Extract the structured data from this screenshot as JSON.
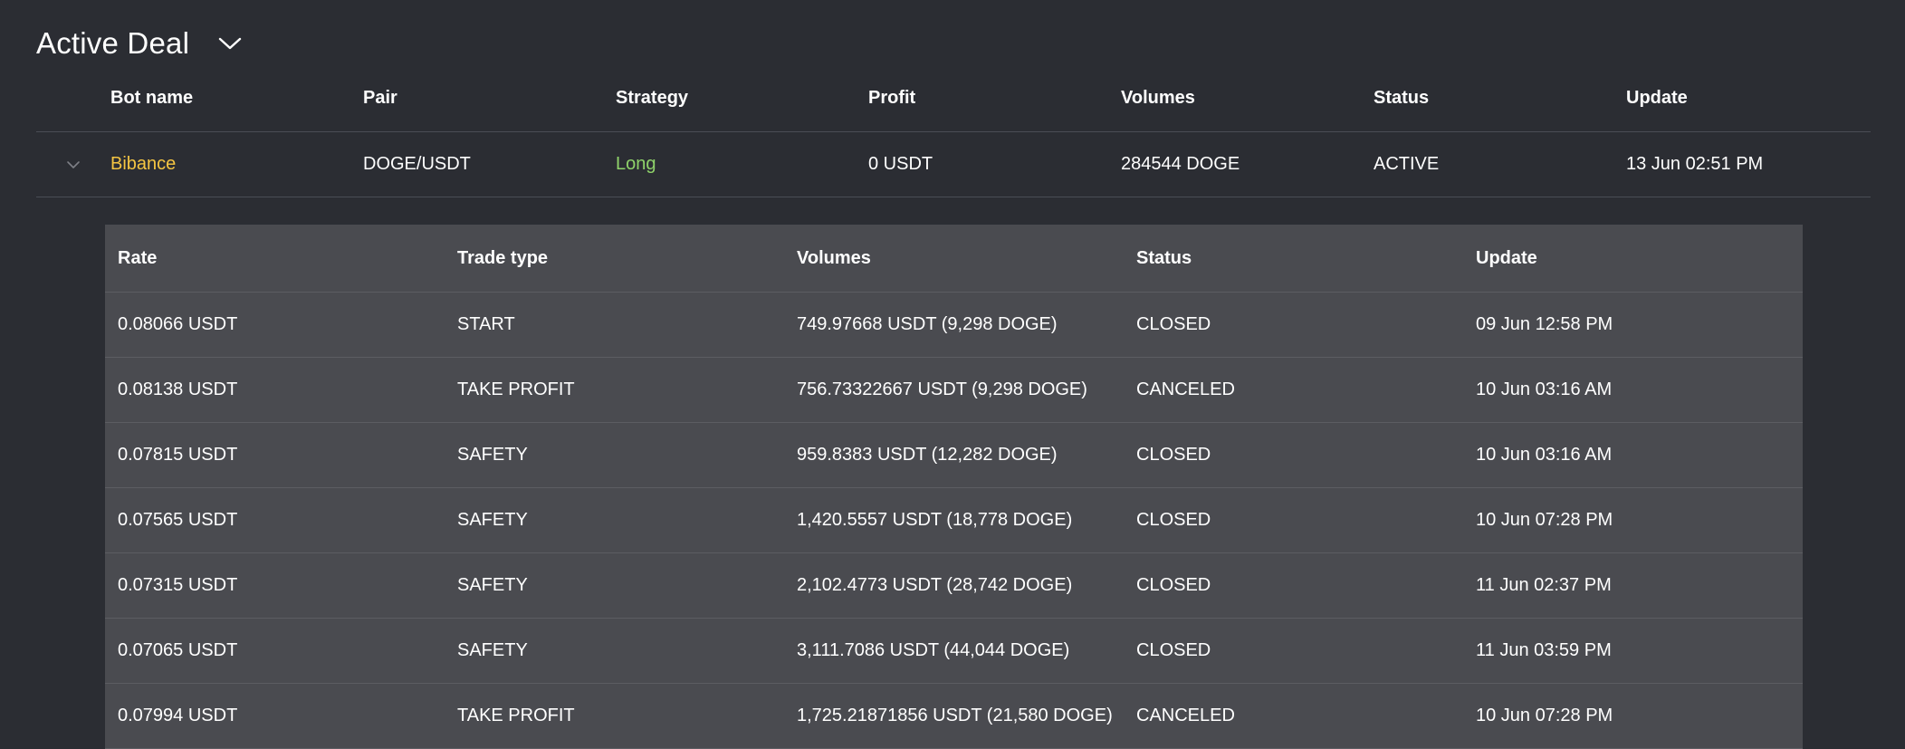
{
  "section": {
    "title": "Active Deal",
    "toggle_icon": "chevron-down-icon"
  },
  "main_table": {
    "columns": [
      "Bot name",
      "Pair",
      "Strategy",
      "Profit",
      "Volumes",
      "Status",
      "Update"
    ],
    "rows": [
      {
        "bot_name": "Bibance",
        "pair": "DOGE/USDT",
        "strategy": "Long",
        "profit": "0 USDT",
        "volumes": "284544 DOGE",
        "status": "ACTIVE",
        "update": "13 Jun 02:51 PM"
      }
    ]
  },
  "sub_table": {
    "columns": [
      "Rate",
      "Trade type",
      "Volumes",
      "Status",
      "Update"
    ],
    "rows": [
      {
        "rate": "0.08066 USDT",
        "trade_type": "START",
        "volumes": "749.97668 USDT (9,298 DOGE)",
        "status": "CLOSED",
        "update": "09 Jun 12:58 PM"
      },
      {
        "rate": "0.08138 USDT",
        "trade_type": "TAKE PROFIT",
        "volumes": "756.73322667 USDT (9,298 DOGE)",
        "status": "CANCELED",
        "update": "10 Jun 03:16 AM"
      },
      {
        "rate": "0.07815 USDT",
        "trade_type": "SAFETY",
        "volumes": "959.8383 USDT (12,282 DOGE)",
        "status": "CLOSED",
        "update": "10 Jun 03:16 AM"
      },
      {
        "rate": "0.07565 USDT",
        "trade_type": "SAFETY",
        "volumes": "1,420.5557 USDT (18,778 DOGE)",
        "status": "CLOSED",
        "update": "10 Jun 07:28 PM"
      },
      {
        "rate": "0.07315 USDT",
        "trade_type": "SAFETY",
        "volumes": "2,102.4773 USDT (28,742 DOGE)",
        "status": "CLOSED",
        "update": "11 Jun 02:37 PM"
      },
      {
        "rate": "0.07065 USDT",
        "trade_type": "SAFETY",
        "volumes": "3,111.7086 USDT (44,044 DOGE)",
        "status": "CLOSED",
        "update": "11 Jun 03:59 PM"
      },
      {
        "rate": "0.07994 USDT",
        "trade_type": "TAKE PROFIT",
        "volumes": "1,725.21871856 USDT (21,580 DOGE)",
        "status": "CANCELED",
        "update": "10 Jun 07:28 PM"
      }
    ]
  },
  "colors": {
    "background": "#2b2d33",
    "sub_table_bg": "#4a4b50",
    "bot_name": "#f5c542",
    "strategy_long": "#8fd36a"
  }
}
